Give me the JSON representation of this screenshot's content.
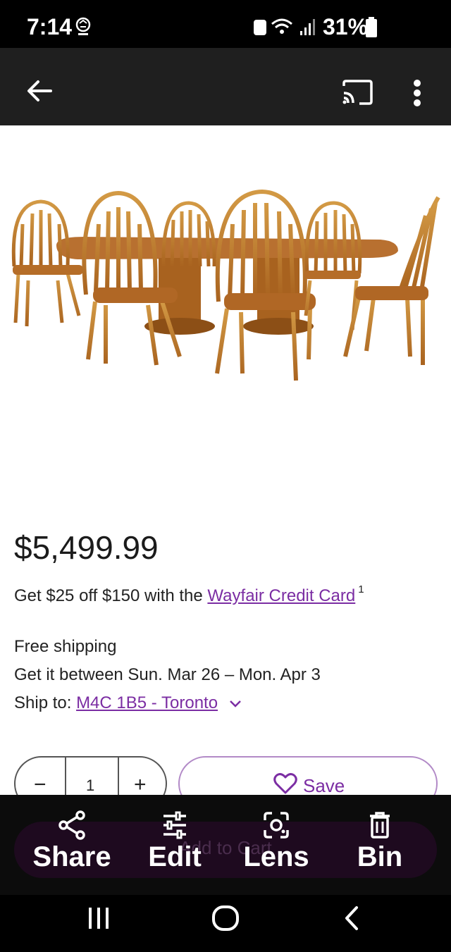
{
  "status_bar": {
    "time": "7:14",
    "battery": "31%"
  },
  "app_bar": {
    "back_icon": "arrow-left-icon",
    "cast_icon": "cast-icon",
    "more_icon": "more-vert-icon"
  },
  "product": {
    "image_description_icon": "product-photo",
    "price": "$5,499.99",
    "promo_prefix": "Get $25 off $150 with the ",
    "promo_link": "Wayfair Credit Card",
    "promo_sup": "1",
    "shipping_line": "Free shipping",
    "delivery_line": "Get it between Sun. Mar 26 – Mon. Apr 3",
    "ship_to_label": "Ship to: ",
    "ship_to_value": "M4C 1B5 - Toronto"
  },
  "quantity": {
    "minus": "−",
    "value": "1",
    "plus": "+"
  },
  "save_button": {
    "label": "Save"
  },
  "add_to_cart": {
    "label": "Add to Cart"
  },
  "share_overlay": {
    "share": "Share",
    "edit": "Edit",
    "lens": "Lens",
    "bin": "Bin"
  },
  "colors": {
    "accent": "#7b2da3",
    "overlay_bg": "#0c0c0c"
  }
}
